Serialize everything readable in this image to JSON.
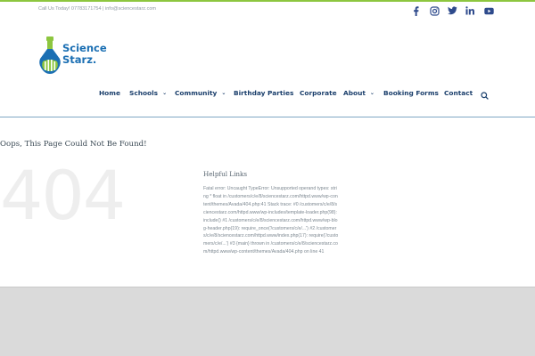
{
  "topbar": {
    "contact": "Call Us Today! 07783171754 | info@sciencestarz.com",
    "accent_color": "#8dc63f"
  },
  "social": [
    {
      "icon": "facebook-icon"
    },
    {
      "icon": "instagram-icon"
    },
    {
      "icon": "twitter-icon"
    },
    {
      "icon": "linkedin-icon"
    },
    {
      "icon": "youtube-icon"
    }
  ],
  "logo": {
    "line1": "Science",
    "line2": "Starz.",
    "text_color": "#1b6fb3",
    "accent_color": "#8dc63f"
  },
  "nav": {
    "items": [
      {
        "label": "Home",
        "dropdown": false
      },
      {
        "label": "Schools",
        "dropdown": true
      },
      {
        "label": "Community",
        "dropdown": true
      },
      {
        "label": "Birthday Parties",
        "dropdown": false
      },
      {
        "label": "Corporate",
        "dropdown": false
      },
      {
        "label": "About",
        "dropdown": true
      },
      {
        "label": "Booking Forms",
        "dropdown": false
      },
      {
        "label": "Contact",
        "dropdown": false
      }
    ],
    "chevron": "⌄",
    "search_icon": "search-icon",
    "text_color": "#1a3e6b"
  },
  "main": {
    "title": "Oops, This Page Could Not Be Found!",
    "code": "404",
    "helpful_heading": "Helpful Links",
    "error": "Fatal error: Uncaught TypeError: Unsupported operand types: string * float in /customers/c/e/8/sciencestarz.com/httpd.www/wp-content/themes/Avada/404.php:41 Stack trace: #0 /customers/c/e/8/sciencestarz.com/httpd.www/wp-includes/template-loader.php(98): include() #1 /customers/c/e/8/sciencestarz.com/httpd.www/wp-blog-header.php(19): require_once('/customers/c/e/...') #2 /customers/c/e/8/sciencestarz.com/httpd.www/index.php(17): require('/customers/c/e/...') #3 {main} thrown in /customers/c/e/8/sciencestarz.com/httpd.www/wp-content/themes/Avada/404.php on line 41"
  }
}
